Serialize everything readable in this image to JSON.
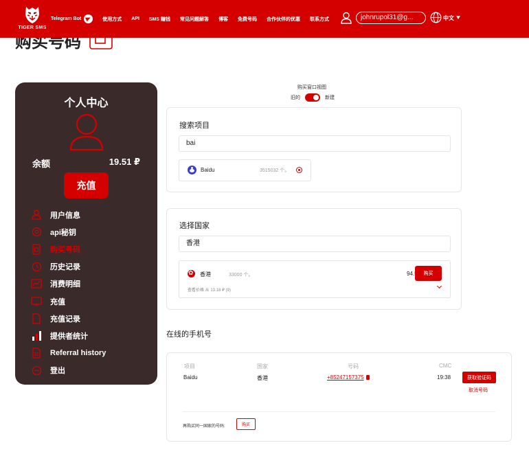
{
  "header": {
    "logo_text": "TIGER SMS",
    "nav": [
      "Telegram Bot",
      "使用方式",
      "API",
      "SMS 赚钱",
      "常见问题解答",
      "博客",
      "免费号码",
      "合作伙伴的优惠",
      "联系方式"
    ],
    "email": "johnrupol31@g...",
    "language": "中文"
  },
  "page": {
    "title": "购买号码"
  },
  "sidebar": {
    "title": "个人中心",
    "balance_label": "余额",
    "balance_value": "19.51 ₽",
    "topup_label": "充值",
    "menu": [
      {
        "label": "用户信息",
        "icon": "user-icon"
      },
      {
        "label": "api秘钥",
        "icon": "key-icon"
      },
      {
        "label": "购买号码",
        "icon": "phone-icon",
        "active": true
      },
      {
        "label": "历史记录",
        "icon": "history-icon"
      },
      {
        "label": "消费明细",
        "icon": "chart-icon"
      },
      {
        "label": "充值",
        "icon": "wallet-icon"
      },
      {
        "label": "充值记录",
        "icon": "document-icon"
      },
      {
        "label": "提供者统计",
        "icon": "stats-icon"
      },
      {
        "label": "Referral history",
        "icon": "referral-icon"
      },
      {
        "label": "登出",
        "icon": "logout-icon"
      }
    ]
  },
  "view_toggle": {
    "title": "购买窗口视图",
    "old_label": "旧的",
    "new_label": "新建"
  },
  "search_service": {
    "title": "搜索项目",
    "value": "bai",
    "result": {
      "name": "Baidu",
      "count": "3515032 个。"
    }
  },
  "select_country": {
    "title": "选择国家",
    "value": "香港",
    "result": {
      "name": "香港",
      "count": "33000 个。",
      "price": "94.5₽",
      "buy_label": "购买",
      "price_note": "查看价格 从 13.18 ₽ (9)"
    }
  },
  "online_numbers": {
    "title": "在线的手机号",
    "headers": [
      "项目",
      "国家",
      "号码",
      "CMC"
    ],
    "rows": [
      {
        "service": "Baidu",
        "country": "香港",
        "number": "+85247157375",
        "cmc": "19:38",
        "get_code_label": "获取验证码",
        "cancel_label": "取消号码"
      }
    ],
    "rebuy_label": "再购买同一国家的号码:",
    "rebuy_button": "购买"
  },
  "colors": {
    "brand_red": "#d40000",
    "sidebar_bg": "#3a2a2a"
  }
}
